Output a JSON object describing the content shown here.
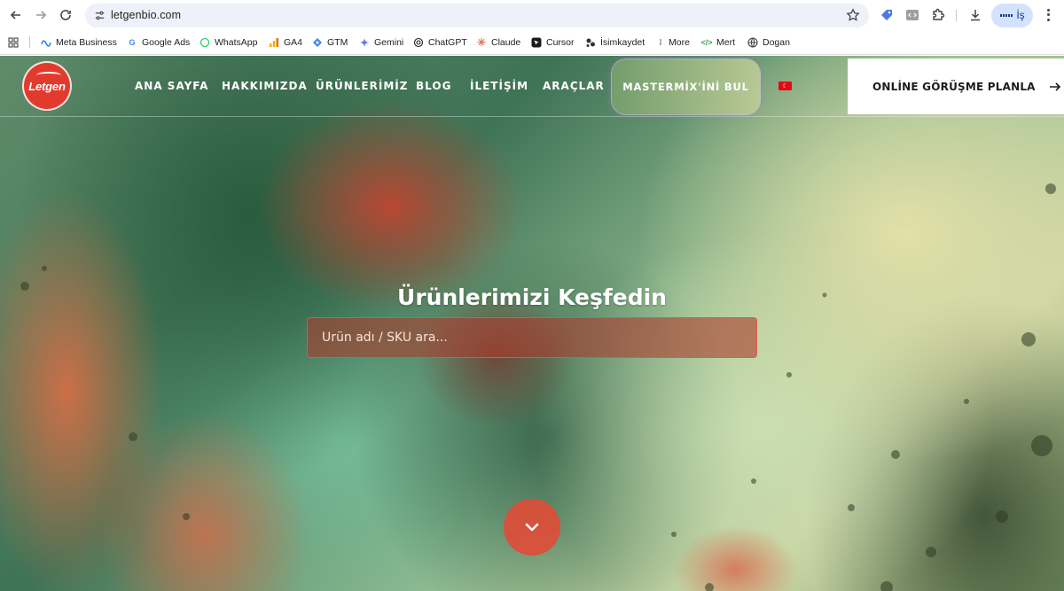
{
  "browser": {
    "url": "letgenbio.com",
    "profile_label": "İş",
    "bookmarks": [
      {
        "label": "Meta Business",
        "icon": "meta-icon"
      },
      {
        "label": "Google Ads",
        "icon": "google-icon"
      },
      {
        "label": "WhatsApp",
        "icon": "whatsapp-icon"
      },
      {
        "label": "GA4",
        "icon": "ga4-icon"
      },
      {
        "label": "GTM",
        "icon": "gtm-icon"
      },
      {
        "label": "Gemini",
        "icon": "gemini-icon"
      },
      {
        "label": "ChatGPT",
        "icon": "chatgpt-icon"
      },
      {
        "label": "Claude",
        "icon": "claude-icon"
      },
      {
        "label": "Cursor",
        "icon": "cursor-icon"
      },
      {
        "label": "İsimkaydet",
        "icon": "isimkaydet-icon"
      },
      {
        "label": "More",
        "icon": "more-icon"
      },
      {
        "label": "Mert",
        "icon": "code-icon"
      },
      {
        "label": "Dogan",
        "icon": "globe-icon"
      }
    ]
  },
  "site": {
    "logo_text": "Letgen",
    "nav": [
      "ANA SAYFA",
      "HAKKIMIZDA",
      "ÜRÜNLERİMİZ",
      "BLOG",
      "İLETİŞİM",
      "ARAÇLAR"
    ],
    "mastermix_cta": "MASTERMİX'İNİ BUL",
    "language_flag": "tr-flag",
    "meeting_cta": "ONLİNE GÖRÜŞME PLANLA",
    "hero_title": "Ürünlerimizi Keşfedin",
    "search_placeholder": "Ürün adı / SKU ara...",
    "colors": {
      "brand_red": "#e23b2e",
      "search_border": "#e65a46"
    }
  }
}
